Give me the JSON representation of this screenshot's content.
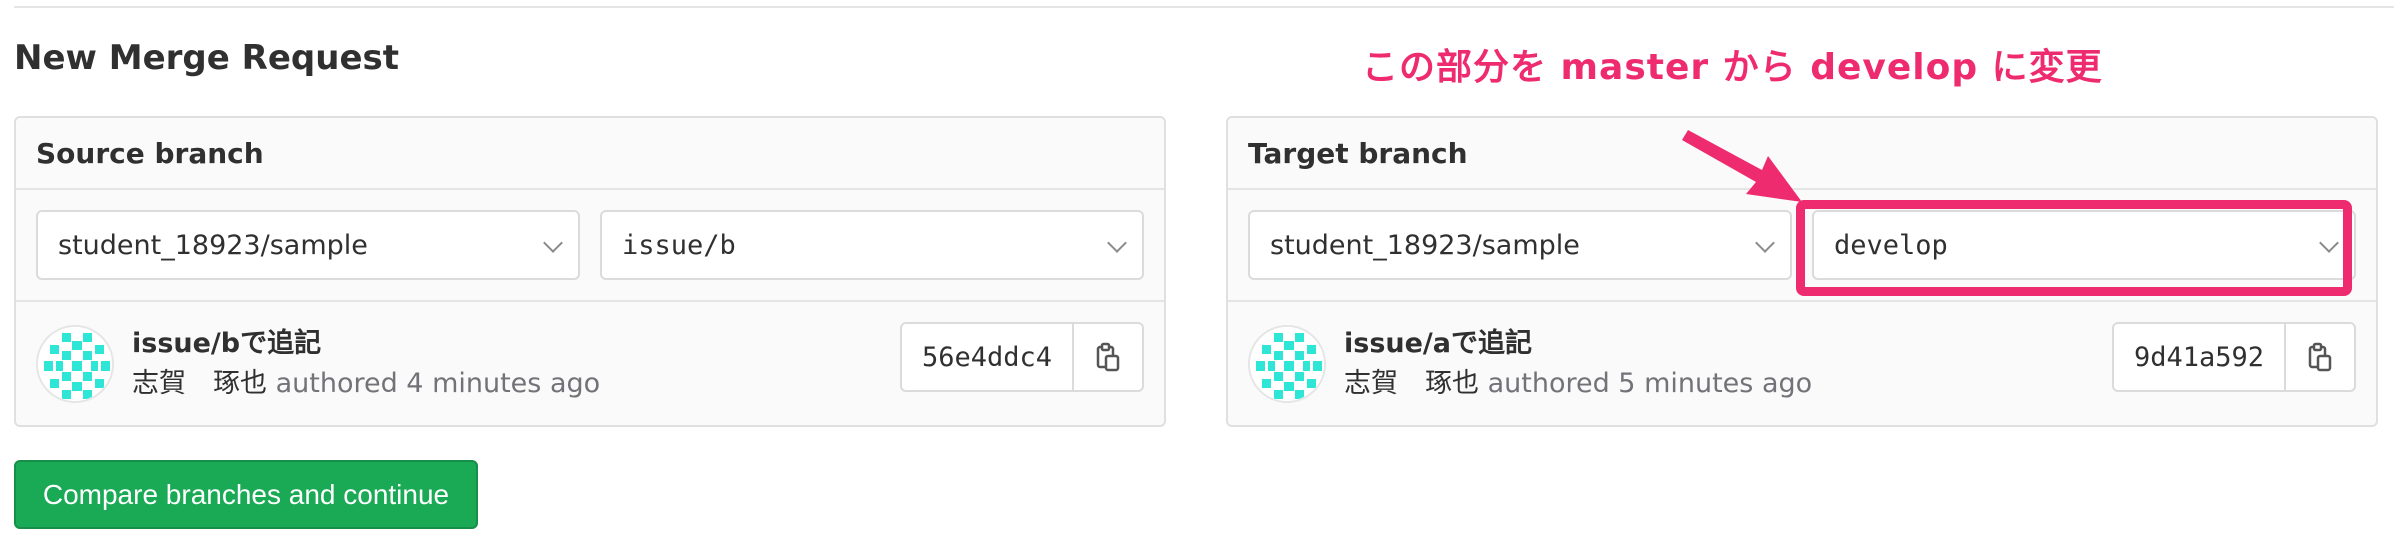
{
  "page": {
    "title": "New Merge Request"
  },
  "annotation": {
    "text": "この部分を master から develop に変更",
    "color": "#ef2b6f"
  },
  "source": {
    "header": "Source branch",
    "project": "student_18923/sample",
    "branch": "issue/b",
    "commit": {
      "title": "issue/bで追記",
      "author": "志賀　琢也",
      "authored": "authored 4 minutes ago",
      "sha": "56e4ddc4"
    }
  },
  "target": {
    "header": "Target branch",
    "project": "student_18923/sample",
    "branch": "develop",
    "commit": {
      "title": "issue/aで追記",
      "author": "志賀　琢也",
      "authored": "authored 5 minutes ago",
      "sha": "9d41a592"
    }
  },
  "actions": {
    "compare_label": "Compare branches and continue"
  },
  "icons": {
    "chevron": "chevron-down-icon",
    "copy": "clipboard-copy-icon",
    "avatar": "identicon-avatar",
    "arrow": "annotation-arrow"
  },
  "colors": {
    "accent": "#ef2b6f",
    "success": "#1aaa55",
    "identicon": "#2ee6d6"
  }
}
